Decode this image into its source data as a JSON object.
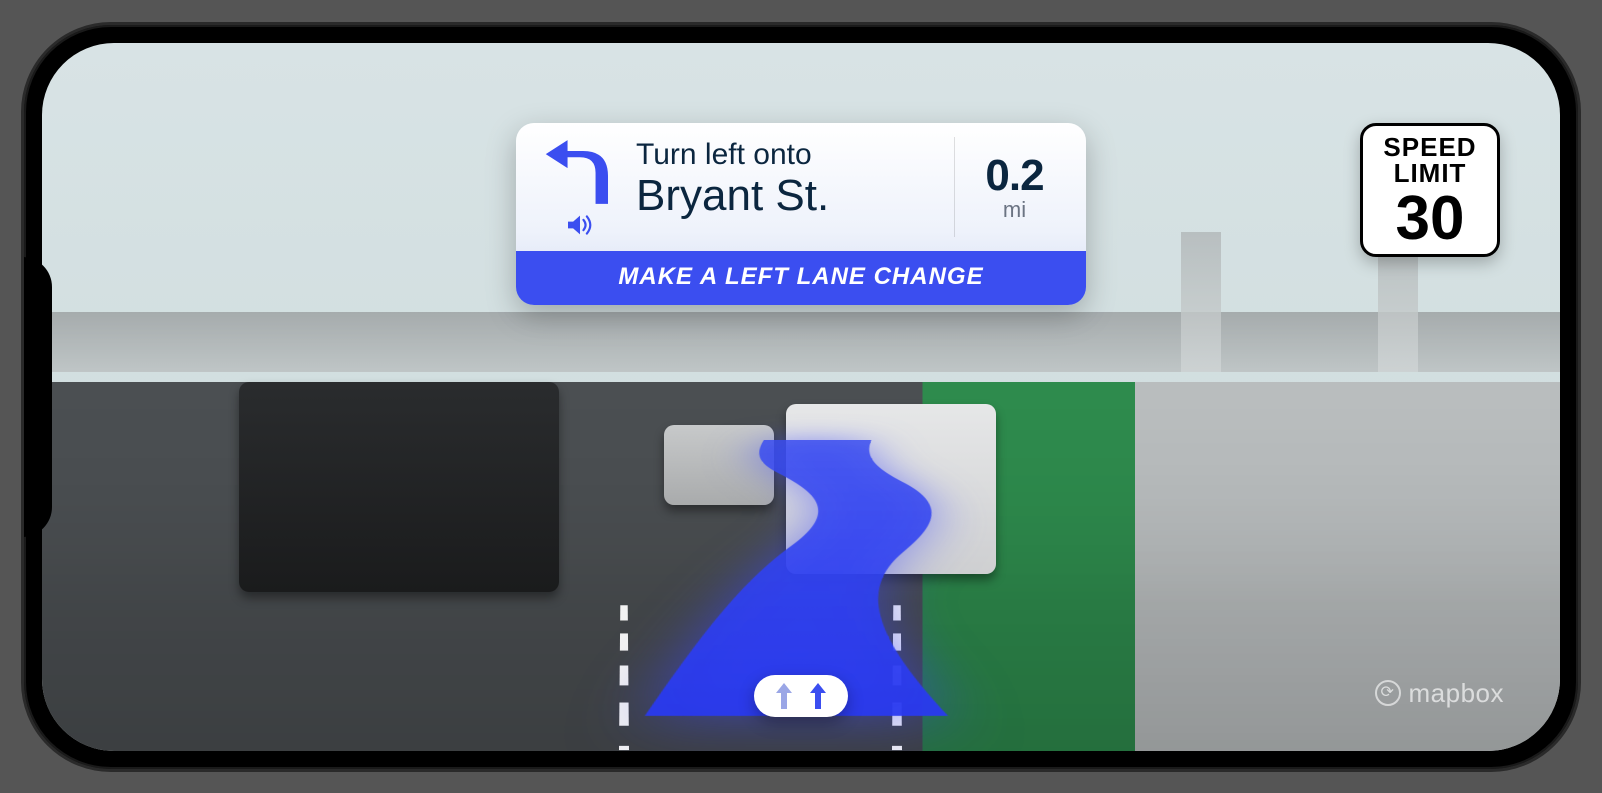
{
  "maneuver": {
    "instruction_prefix": "Turn left onto",
    "street": "Bryant St.",
    "distance_value": "0.2",
    "distance_unit": "mi",
    "sub_instruction": "MAKE A LEFT LANE CHANGE"
  },
  "speed_limit": {
    "label_line1": "SPEED",
    "label_line2": "LIMIT",
    "value": "30"
  },
  "lanes": {
    "left_active": true,
    "right_active": true
  },
  "attribution": {
    "brand": "mapbox"
  },
  "colors": {
    "accent": "#3b4ef0",
    "text_dark": "#0b263f"
  }
}
